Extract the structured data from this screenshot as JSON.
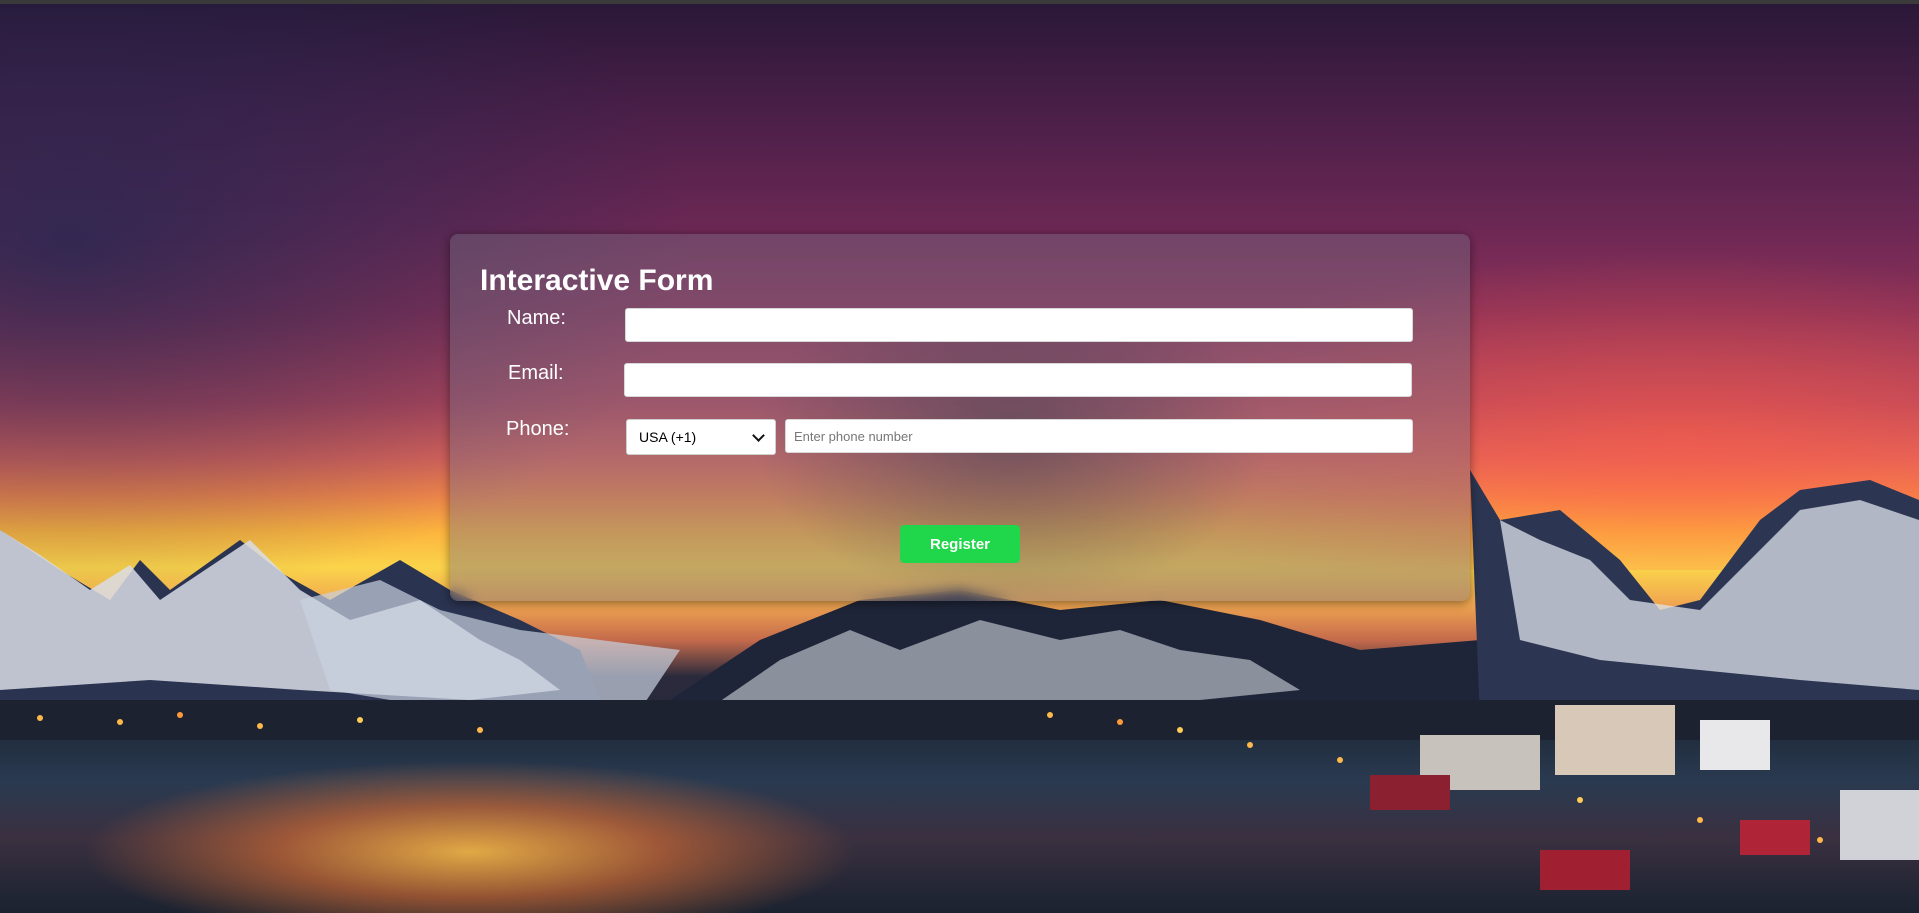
{
  "form": {
    "title": "Interactive Form",
    "name_label": "Name:",
    "name_value": "",
    "email_label": "Email:",
    "email_value": "",
    "phone_label": "Phone:",
    "country_selected": "USA (+1)",
    "phone_value": "",
    "phone_placeholder": "Enter phone number",
    "register_label": "Register"
  },
  "icons": {
    "select_arrow": "chevron-down-icon"
  },
  "colors": {
    "register_button": "#20d64a",
    "card_overlay": "rgba(120,110,130,0.42)",
    "text": "#ffffff"
  }
}
